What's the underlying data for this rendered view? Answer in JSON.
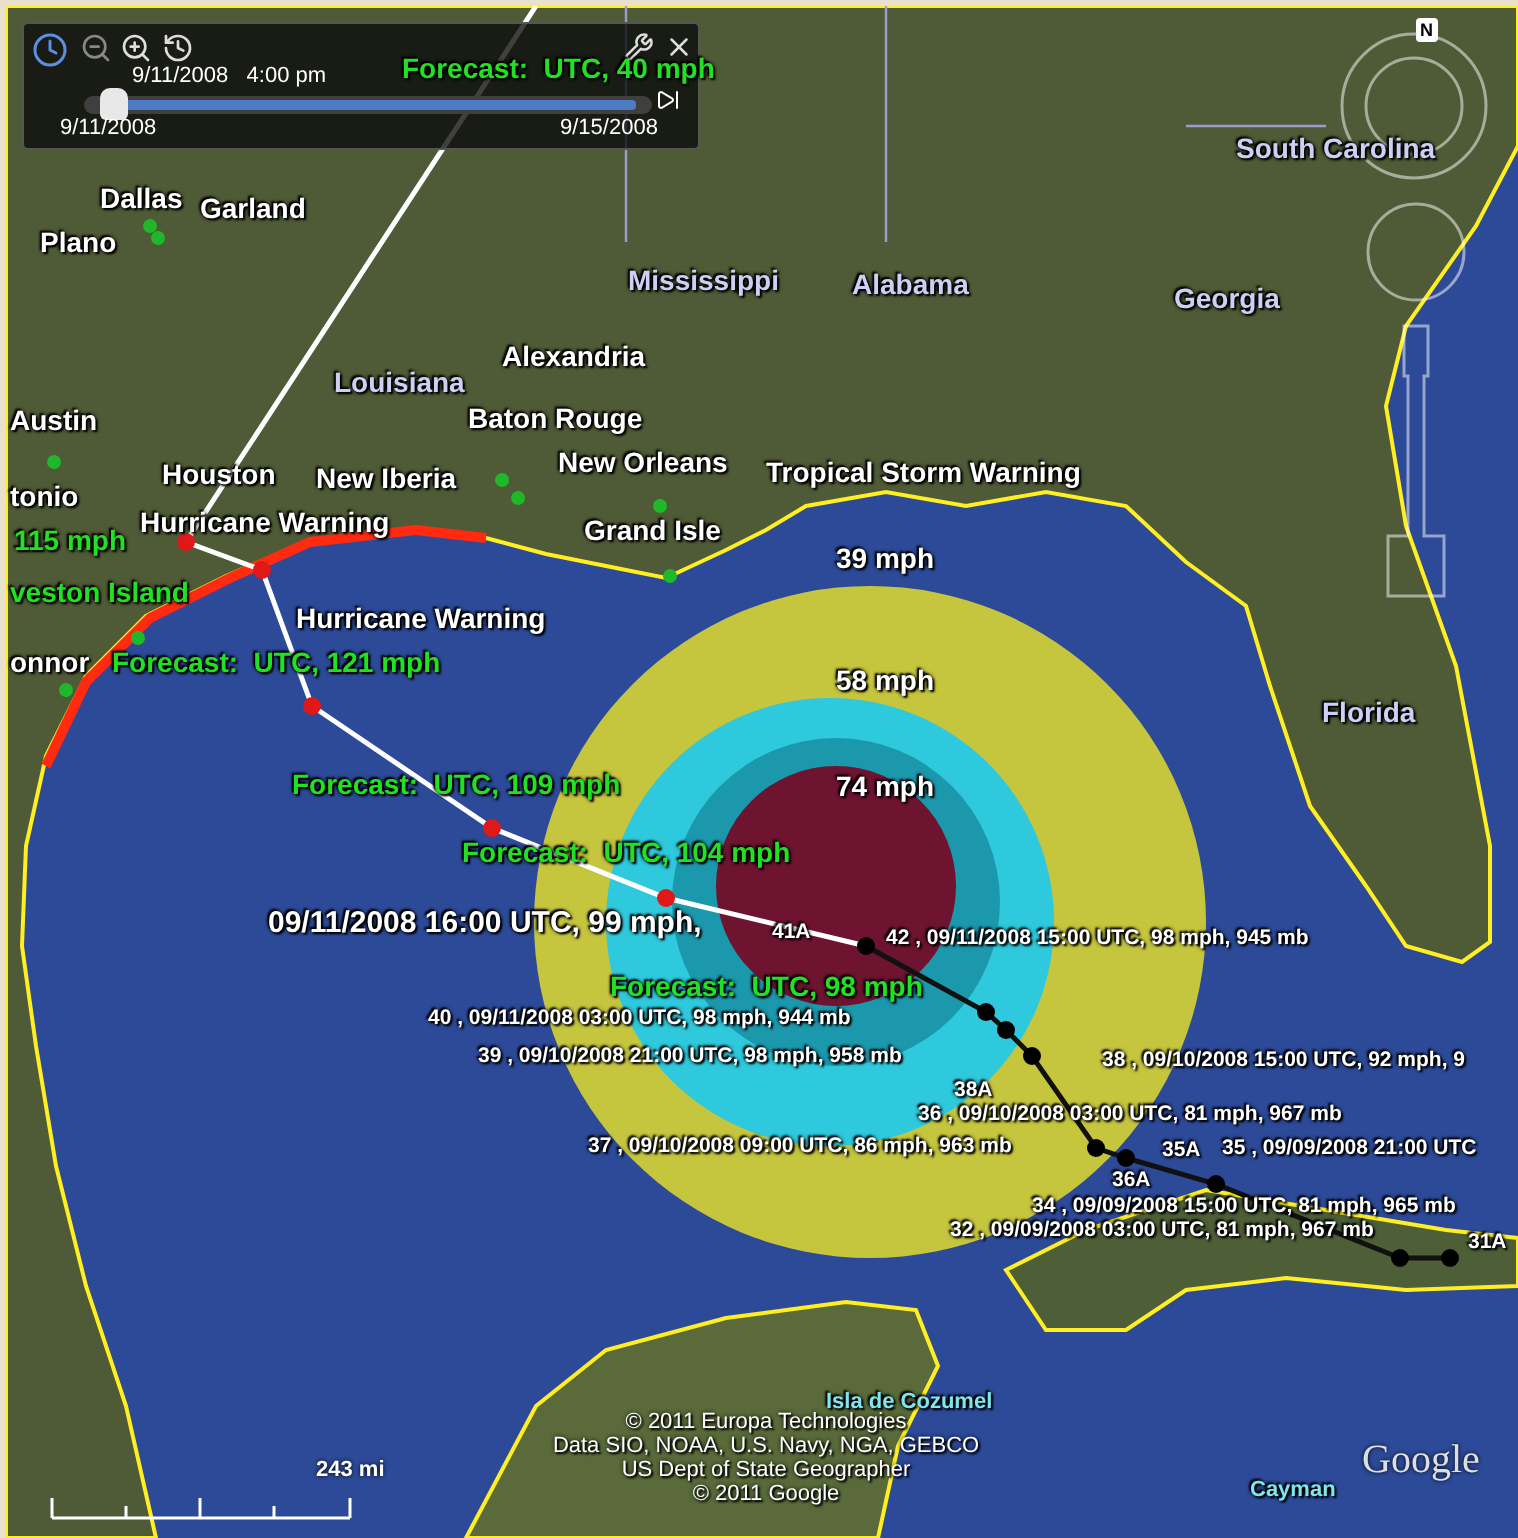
{
  "time_slider": {
    "current": "9/11/2008   4:00 pm",
    "start": "9/11/2008",
    "end": "9/15/2008",
    "level": 0.03
  },
  "compass": {
    "label": "N"
  },
  "map_labels": [
    {
      "text": "Forecast:  UTC, 40 mph",
      "kind": "forecast"
    },
    {
      "text": "South Carolina",
      "kind": "state"
    },
    {
      "text": "Dallas",
      "kind": "place"
    },
    {
      "text": "Garland",
      "kind": "place"
    },
    {
      "text": "Plano",
      "kind": "place"
    },
    {
      "text": "Mississippi",
      "kind": "state"
    },
    {
      "text": "Alabama",
      "kind": "state"
    },
    {
      "text": "Georgia",
      "kind": "state"
    },
    {
      "text": "Alexandria",
      "kind": "place"
    },
    {
      "text": "Louisiana",
      "kind": "state"
    },
    {
      "text": "Baton Rouge",
      "kind": "place"
    },
    {
      "text": "Austin",
      "kind": "place"
    },
    {
      "text": "New Orleans",
      "kind": "place"
    },
    {
      "text": "Houston",
      "kind": "place"
    },
    {
      "text": "New Iberia",
      "kind": "place"
    },
    {
      "text": "tonio",
      "kind": "place"
    },
    {
      "text": "Tropical Storm Warning",
      "kind": "warning"
    },
    {
      "text": "Hurricane Warning",
      "kind": "warning"
    },
    {
      "text": "Grand Isle",
      "kind": "place"
    },
    {
      "text": "115 mph",
      "kind": "forecast"
    },
    {
      "text": "39 mph",
      "kind": "wind"
    },
    {
      "text": "veston Island",
      "kind": "forecast"
    },
    {
      "text": "Hurricane Warning",
      "kind": "warning"
    },
    {
      "text": "onnor",
      "kind": "place"
    },
    {
      "text": "Forecast:  UTC, 121 mph",
      "kind": "forecast"
    },
    {
      "text": "58 mph",
      "kind": "wind"
    },
    {
      "text": "Florida",
      "kind": "state"
    },
    {
      "text": "Forecast:  UTC, 109 mph",
      "kind": "forecast"
    },
    {
      "text": "74 mph",
      "kind": "wind"
    },
    {
      "text": "Forecast:  UTC, 104 mph",
      "kind": "forecast"
    },
    {
      "text": "09/11/2008 16:00 UTC, 99 mph,",
      "kind": "position"
    },
    {
      "text": "41A",
      "kind": "advisory"
    },
    {
      "text": "42 , 09/11/2008 15:00 UTC, 98 mph, 945 mb",
      "kind": "track"
    },
    {
      "text": "Forecast:  UTC, 98 mph",
      "kind": "forecast"
    },
    {
      "text": "40 , 09/11/2008 03:00 UTC, 98 mph, 944 mb",
      "kind": "track"
    },
    {
      "text": "39 , 09/10/2008 21:00 UTC, 98 mph, 958 mb",
      "kind": "track"
    },
    {
      "text": "38 , 09/10/2008 15:00 UTC, 92 mph, 9",
      "kind": "track"
    },
    {
      "text": "38A",
      "kind": "advisory"
    },
    {
      "text": "36 , 09/10/2008 03:00 UTC, 81 mph, 967 mb",
      "kind": "track"
    },
    {
      "text": "37 , 09/10/2008 09:00 UTC, 86 mph, 963 mb",
      "kind": "track"
    },
    {
      "text": "35A",
      "kind": "advisory"
    },
    {
      "text": "35 , 09/09/2008 21:00 UTC",
      "kind": "track"
    },
    {
      "text": "36A",
      "kind": "advisory"
    },
    {
      "text": "34 , 09/09/2008 15:00 UTC, 81 mph, 965 mb",
      "kind": "track"
    },
    {
      "text": "32 , 09/09/2008 03:00 UTC, 81 mph, 967 mb",
      "kind": "track"
    },
    {
      "text": "31A",
      "kind": "advisory"
    },
    {
      "text": "Isla de Cozumel",
      "kind": "island"
    },
    {
      "text": "Cayman",
      "kind": "island"
    }
  ],
  "scale_bar": {
    "label": "243 mi"
  },
  "attribution": [
    "© 2011 Europa Technologies",
    "Data SIO, NOAA, U.S. Navy, NGA, GEBCO",
    "US Dept of State Geographer",
    "© 2011 Google"
  ],
  "logo": {
    "text": "Google"
  }
}
